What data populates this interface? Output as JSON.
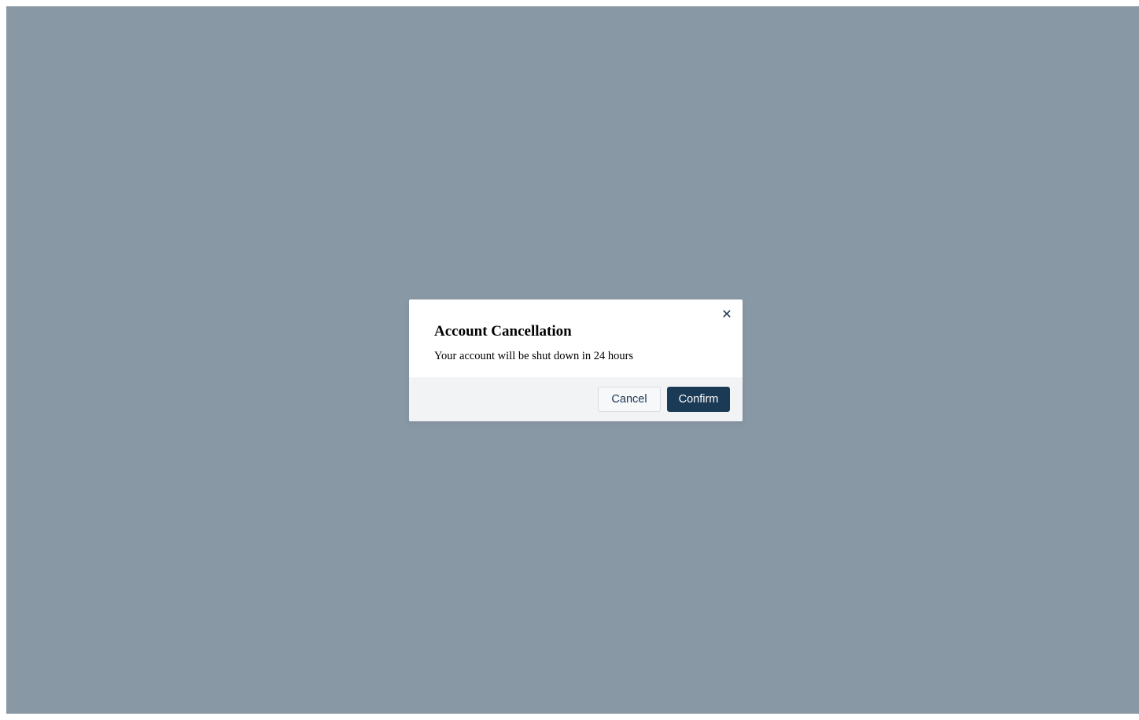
{
  "dialog": {
    "title": "Account Cancellation",
    "message": "Your account will be shut down in 24 hours",
    "close_icon": "close-icon",
    "cancel_label": "Cancel",
    "confirm_label": "Confirm"
  },
  "colors": {
    "overlay": "#8998a5",
    "primary": "#1b3a55",
    "footer": "#f2f3f5"
  }
}
